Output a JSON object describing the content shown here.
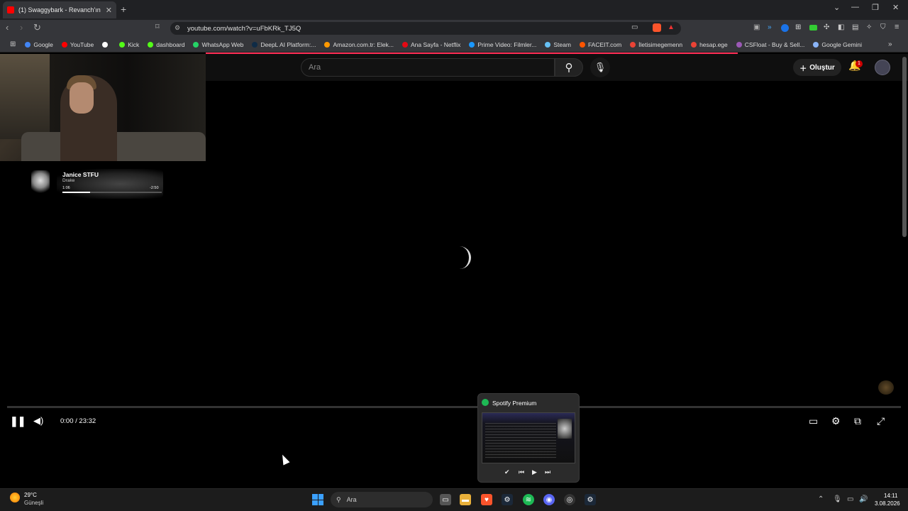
{
  "browser": {
    "tab_title": "(1) Swaggybark - Revanch'ın Ch...",
    "new_tab": "+",
    "url": "youtube.com/watch?v=uFbKRk_TJ5Q",
    "bookmarks": [
      {
        "label": "Google",
        "color": "#4285f4"
      },
      {
        "label": "YouTube",
        "color": "#ff0000"
      },
      {
        "label": "",
        "color": "#ffffff"
      },
      {
        "label": "Kick",
        "color": "#53fc18"
      },
      {
        "label": "dashboard",
        "color": "#53fc18"
      },
      {
        "label": "WhatsApp Web",
        "color": "#25d366"
      },
      {
        "label": "DeepL AI Platform:...",
        "color": "#0f2b46"
      },
      {
        "label": "Amazon.com.tr: Elek...",
        "color": "#ff9900"
      },
      {
        "label": "Ana Sayfa - Netflix",
        "color": "#e50914"
      },
      {
        "label": "Prime Video: Filmler...",
        "color": "#1a98ff"
      },
      {
        "label": "Steam",
        "color": "#66c0f4"
      },
      {
        "label": "FACEIT.com",
        "color": "#ff5500"
      },
      {
        "label": "İletisimegemenn",
        "color": "#ea4335"
      },
      {
        "label": "hesap.ege",
        "color": "#ea4335"
      },
      {
        "label": "CSFloat - Buy & Sell...",
        "color": "#9b59b6"
      },
      {
        "label": "Google Gemini",
        "color": "#8ab4f8"
      }
    ]
  },
  "youtube": {
    "search_placeholder": "Ara",
    "create_label": "Oluştur",
    "notification_count": "1"
  },
  "now_playing": {
    "title": "Janice STFU",
    "artist": "Drake",
    "elapsed": "1:06",
    "remaining": "-2:50",
    "progress": 0.28
  },
  "player": {
    "time": "0:00 / 23:32"
  },
  "spotify_popup": {
    "title": "Spotify Premium"
  },
  "taskbar": {
    "weather_temp": "29°C",
    "weather_desc": "Güneşli",
    "search_label": "Ara",
    "time": "14:11",
    "date": "3.08.2026"
  }
}
